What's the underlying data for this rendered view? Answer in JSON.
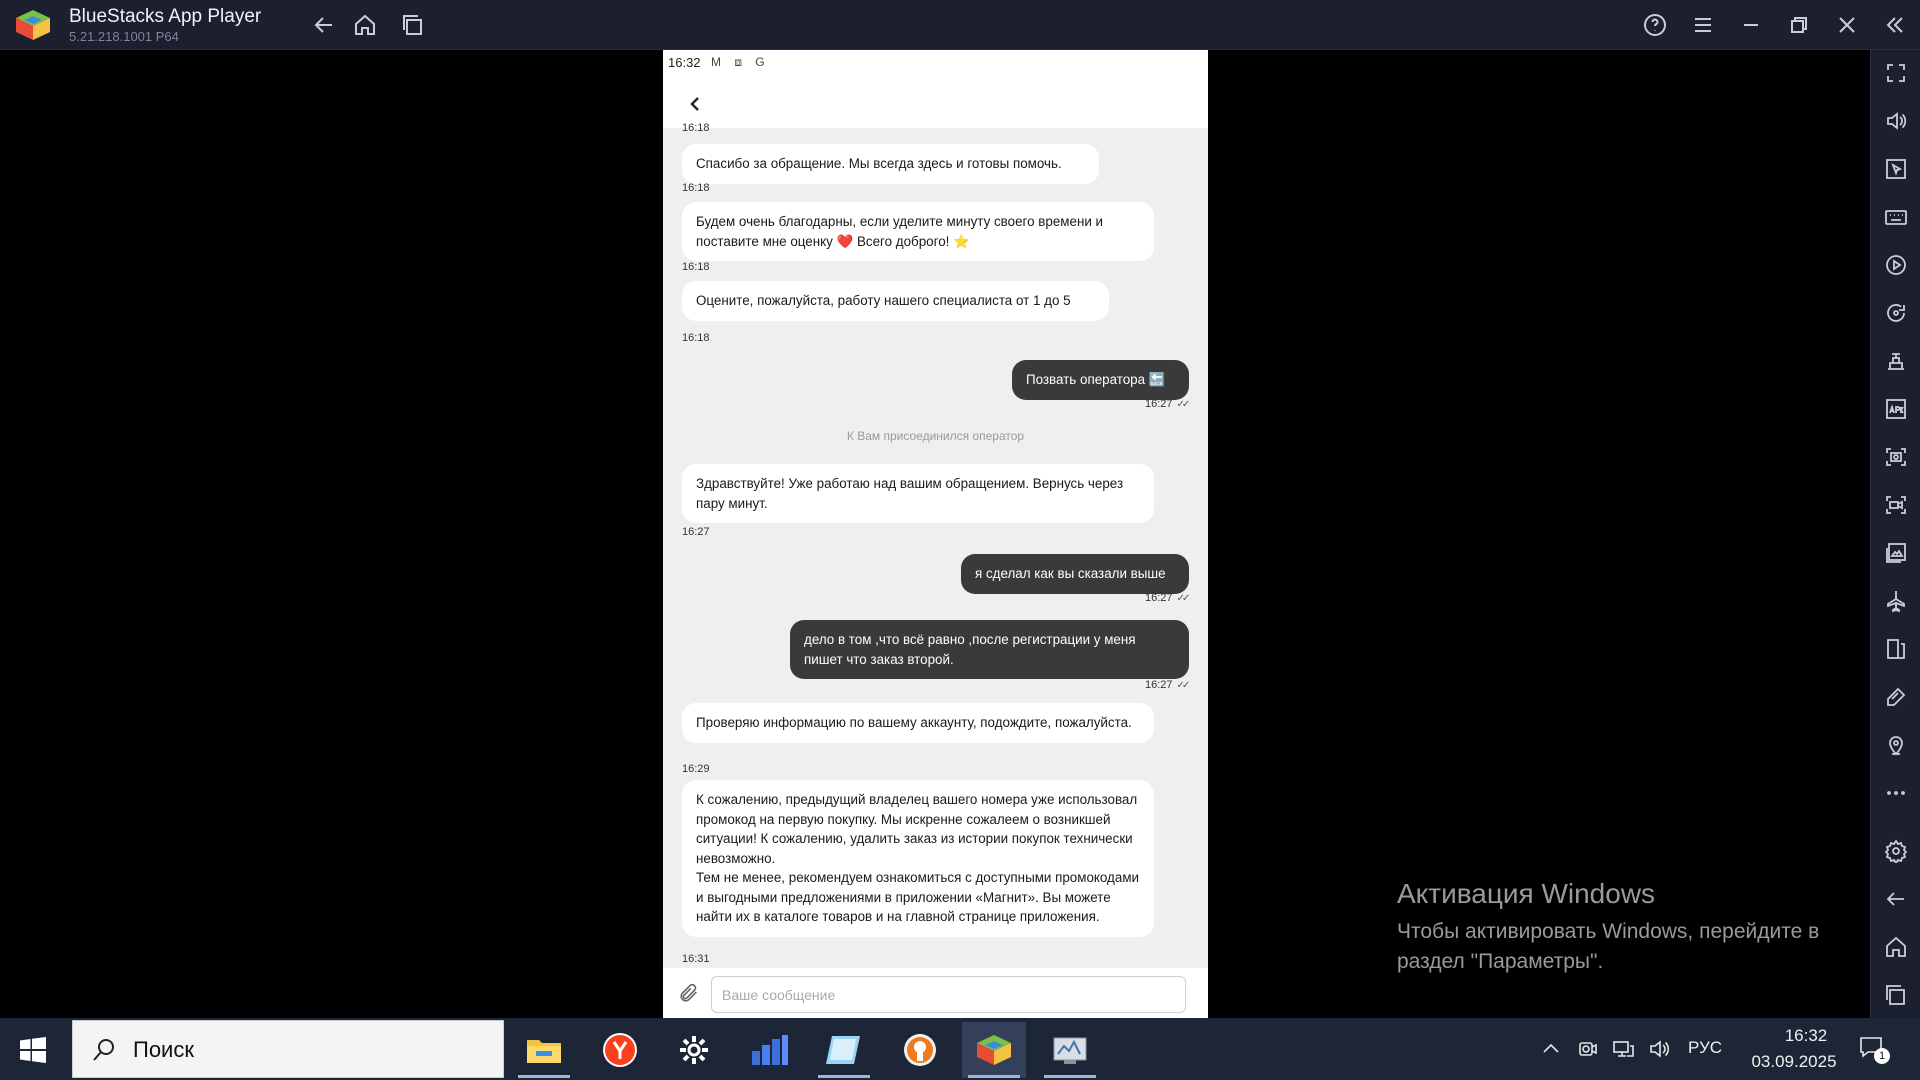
{
  "window": {
    "title": "BlueStacks App Player",
    "version": "5.21.218.1001  P64"
  },
  "titlebar_icons": [
    "back-icon",
    "home-icon",
    "multi-instance-icon",
    "help-icon",
    "menu-icon",
    "minimize-icon",
    "restore-icon",
    "close-icon",
    "collapse-sidebar-icon"
  ],
  "android": {
    "status_time": "16:32",
    "status_icons": "M ⧈ G"
  },
  "chat": {
    "partial_timestamp": "16:18",
    "messages": [
      {
        "side": "in",
        "text": "Спасибо за обращение. Мы всегда здесь и готовы помочь.",
        "time": "16:18"
      },
      {
        "side": "in",
        "text": "Будем очень благодарны, если уделите минуту своего времени и поставите мне оценку ❤️ Всего доброго! ⭐",
        "time": "16:18"
      },
      {
        "side": "in",
        "text": "Оцените, пожалуйста, работу нашего специалиста от 1 до 5",
        "time": "16:18"
      },
      {
        "side": "out",
        "text": "Позвать оператора 🔙",
        "time": "16:27"
      },
      {
        "side": "in",
        "text": "Здравствуйте! Уже работаю над вашим обращением. Вернусь через пару минут.",
        "time": "16:27"
      },
      {
        "side": "out",
        "text": "я сделал как вы сказали выше",
        "time": "16:27"
      },
      {
        "side": "out",
        "text": "дело в том ,что всё равно ,после регистрации у меня пишет что заказ второй.",
        "time": "16:27"
      },
      {
        "side": "in",
        "text": "Проверяю информацию по вашему аккаунту, подождите, пожалуйста.",
        "time": "16:29"
      },
      {
        "side": "in",
        "text": "К сожалению, предыдущий владелец вашего номера уже использовал промокод на первую покупку. Мы искренне сожалеем о возникшей ситуации! К сожалению, удалить заказ из истории покупок технически невозможно.\nТем не менее, рекомендуем ознакомиться с доступными промокодами и выгодными предложениями в приложении «Магнит». Вы можете найти их в каталоге товаров и на главной странице приложения.",
        "time": "16:31"
      }
    ],
    "system_notice": "К Вам присоединился оператор",
    "input_placeholder": "Ваше сообщение",
    "input_value": ""
  },
  "sidebar_icons": [
    "fullscreen-icon",
    "volume-icon",
    "screen-cursor-icon",
    "keyboard-icon",
    "macro-record-icon",
    "rotate-sync-icon",
    "game-controls-icon",
    "install-apk-icon",
    "screenshot-icon",
    "screen-record-icon",
    "media-folder-icon",
    "airplane-mode-icon",
    "multi-instance-manager-icon",
    "eco-mode-icon",
    "location-icon",
    "more-icon",
    "settings-icon",
    "back-icon",
    "home-icon",
    "recent-apps-icon"
  ],
  "watermark": {
    "title": "Активация Windows",
    "text": "Чтобы активировать Windows, перейдите в раздел \"Параметры\"."
  },
  "taskbar": {
    "search_label": "Поиск",
    "apps": [
      "file-explorer-icon",
      "yandex-browser-icon",
      "settings-gear-icon",
      "chart-app-icon",
      "notes-app-icon",
      "vpn-app-icon",
      "bluestacks-icon",
      "network-monitor-icon"
    ],
    "language": "РУС",
    "time": "16:32",
    "date": "03.09.2025",
    "notification_count": "1"
  },
  "colors": {
    "titlebar_bg": "#1c1f2e",
    "chat_bg": "#efefef",
    "outgoing_bubble": "#3a3a3a",
    "incoming_bubble": "#ffffff",
    "taskbar_bg": "#1d2636"
  }
}
